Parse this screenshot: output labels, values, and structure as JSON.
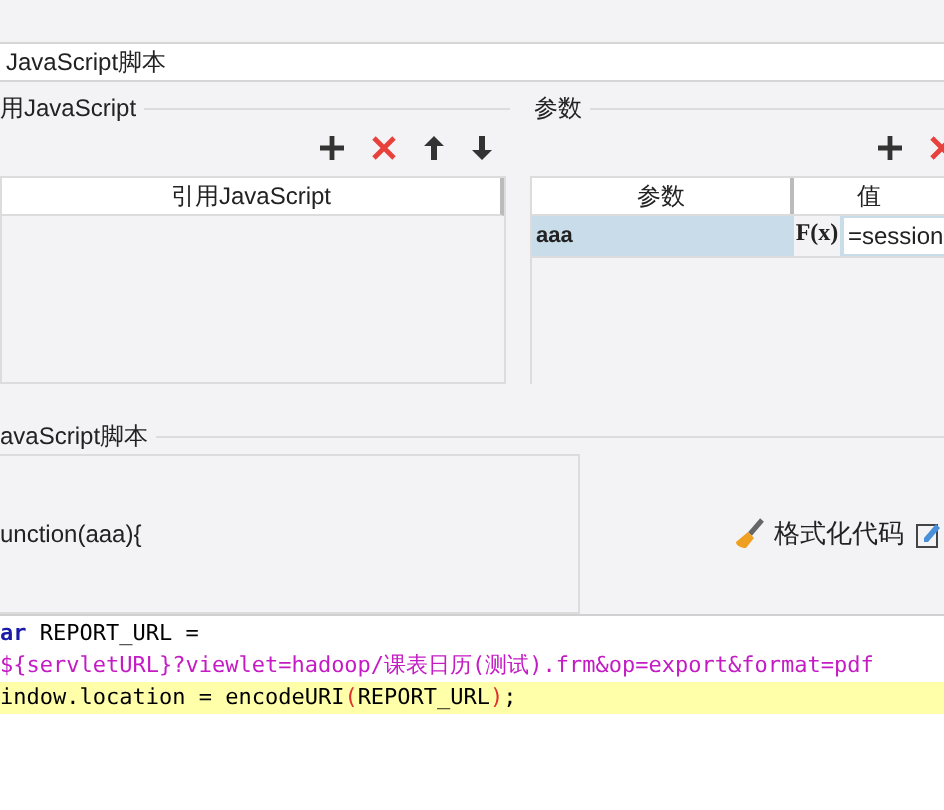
{
  "title_field": {
    "value": "JavaScript脚本"
  },
  "references": {
    "legend": "用JavaScript",
    "column": "引用JavaScript"
  },
  "params": {
    "legend": "参数",
    "columns": [
      "参数",
      "值"
    ],
    "rows": [
      {
        "name": "aaa",
        "selected": true,
        "formula": "F(x)",
        "value": "=session"
      }
    ]
  },
  "script": {
    "legend": "avaScript脚本",
    "signature": "unction(aaa){",
    "format_button": "格式化代码"
  },
  "code_lines": [
    {
      "highlighted": false,
      "tokens": [
        {
          "kind": "keyword",
          "text": "ar"
        },
        {
          "kind": "plain",
          "text": " REPORT_URL ="
        }
      ]
    },
    {
      "highlighted": false,
      "tokens": [
        {
          "kind": "string",
          "text": "${servletURL}?viewlet=hadoop/课表日历(测试).frm&op=export&format=pdf"
        }
      ]
    },
    {
      "highlighted": true,
      "tokens": [
        {
          "kind": "plain",
          "text": "indow.location = encodeURI"
        },
        {
          "kind": "paren",
          "text": "("
        },
        {
          "kind": "plain",
          "text": "REPORT_URL"
        },
        {
          "kind": "paren",
          "text": ")"
        },
        {
          "kind": "plain",
          "text": ";"
        }
      ]
    }
  ]
}
